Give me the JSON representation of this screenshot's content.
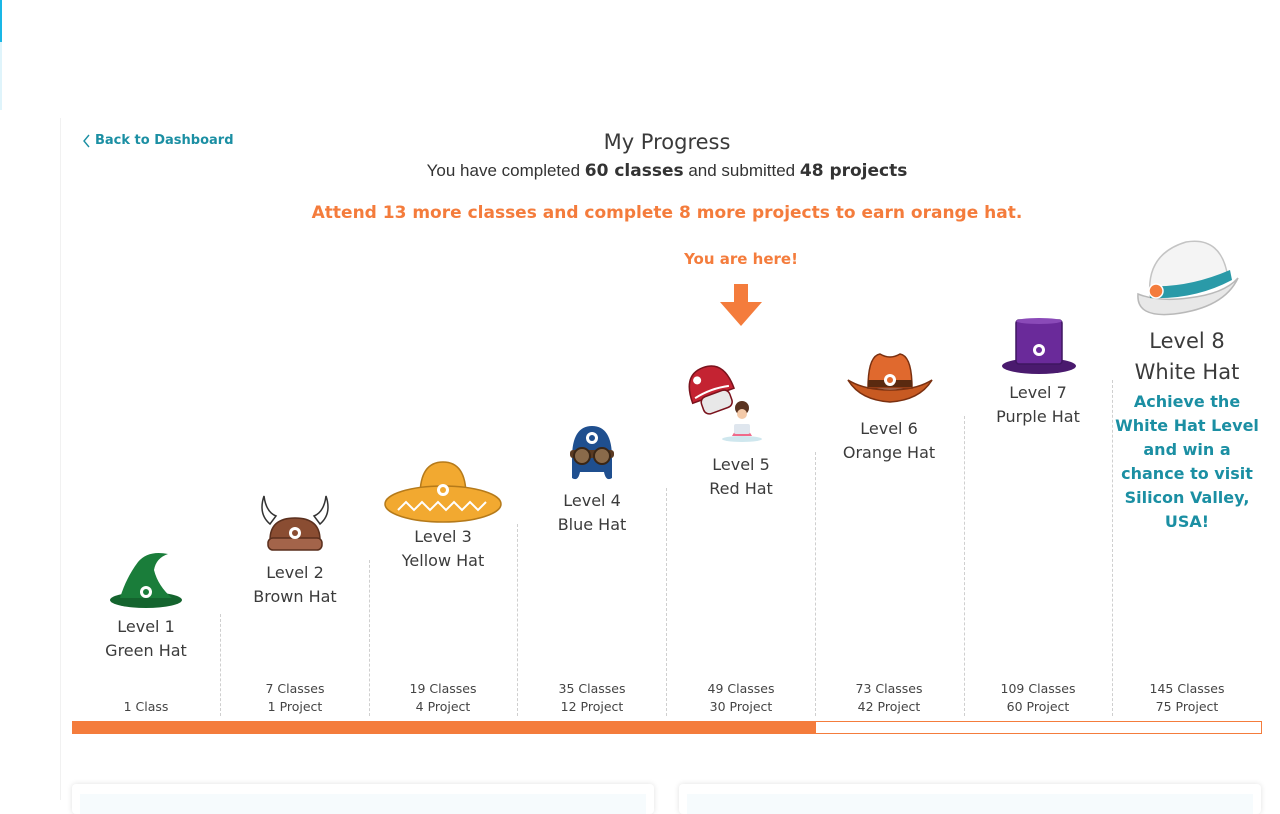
{
  "nav": {
    "back_label": "Back to Dashboard"
  },
  "header": {
    "title": "My Progress",
    "completed_prefix": "You have completed ",
    "classes_done": "60 classes",
    "completed_middle": " and submitted ",
    "projects_done": "48 projects",
    "goal_message": "Attend 13 more classes and complete 8 more projects to earn orange hat."
  },
  "current": {
    "label": "You are here!"
  },
  "levels": [
    {
      "level": "Level 1",
      "hat": "Green Hat",
      "classes": "1 Class",
      "projects": "",
      "icon": "green-wizard-hat-icon",
      "color": "#1a7d3a"
    },
    {
      "level": "Level 2",
      "hat": "Brown Hat",
      "classes": "7 Classes",
      "projects": "1 Project",
      "icon": "brown-viking-helmet-icon",
      "color": "#8a4d32"
    },
    {
      "level": "Level 3",
      "hat": "Yellow Hat",
      "classes": "19 Classes",
      "projects": "4 Project",
      "icon": "yellow-sombrero-icon",
      "color": "#f2a930"
    },
    {
      "level": "Level 4",
      "hat": "Blue Hat",
      "classes": "35 Classes",
      "projects": "12 Project",
      "icon": "blue-aviator-cap-icon",
      "color": "#1f4f8f"
    },
    {
      "level": "Level 5",
      "hat": "Red Hat",
      "classes": "49 Classes",
      "projects": "30 Project",
      "icon": "red-cap-icon",
      "color": "#c42332"
    },
    {
      "level": "Level 6",
      "hat": "Orange Hat",
      "classes": "73 Classes",
      "projects": "42 Project",
      "icon": "orange-cowboy-hat-icon",
      "color": "#e0692e"
    },
    {
      "level": "Level 7",
      "hat": "Purple Hat",
      "classes": "109 Classes",
      "projects": "60 Project",
      "icon": "purple-top-hat-icon",
      "color": "#6a2a9a"
    },
    {
      "level": "Level 8",
      "hat": "White Hat",
      "classes": "145 Classes",
      "projects": "75 Project",
      "icon": "white-fedora-icon",
      "color": "#f2f2f2"
    }
  ],
  "final_promo": "Achieve the White Hat Level and win a chance to visit Silicon Valley, USA!",
  "progress": {
    "fraction": 0.625
  },
  "colors": {
    "accent": "#f47c3c",
    "teal": "#1b8fa3"
  }
}
